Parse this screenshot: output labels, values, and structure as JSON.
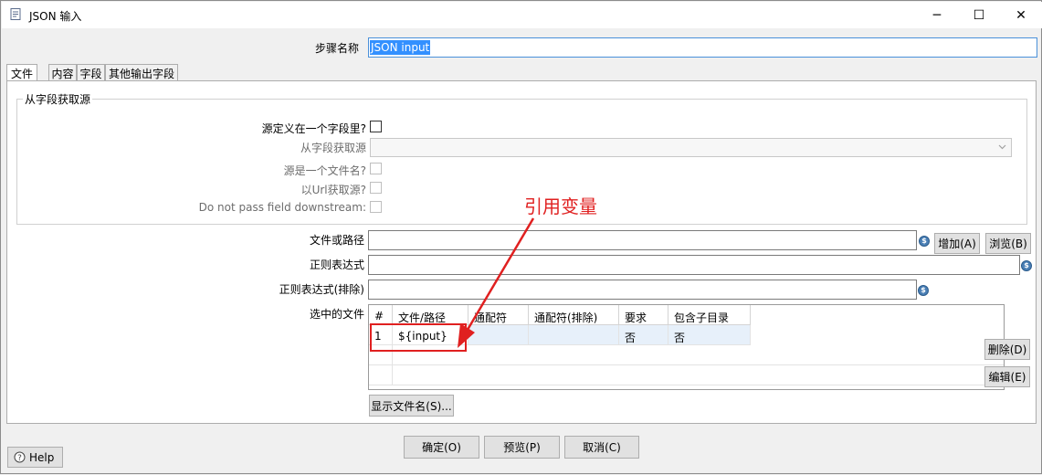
{
  "window": {
    "title": "JSON 输入",
    "minimize_glyph": "─",
    "maximize_glyph": "☐",
    "close_glyph": "✕"
  },
  "step": {
    "label": "步骤名称",
    "value": "JSON input"
  },
  "tabs": [
    {
      "label": "文件",
      "active": true
    },
    {
      "label": "内容",
      "active": false
    },
    {
      "label": "字段",
      "active": false
    },
    {
      "label": "其他输出字段",
      "active": false
    }
  ],
  "source_group": {
    "title": "从字段获取源",
    "source_in_field_label": "源定义在一个字段里?",
    "get_source_from_field_label": "从字段获取源",
    "source_is_filename_label": "源是一个文件名?",
    "read_source_as_url_label": "以Url获取源?",
    "do_not_pass_field_label": "Do not pass field downstream:"
  },
  "file": {
    "file_or_dir_label": "文件或路径",
    "add_button": "增加(A)",
    "browse_button": "浏览(B)",
    "regex_label": "正则表达式",
    "regex_exclude_label": "正则表达式(排除)",
    "selected_files_label": "选中的文件",
    "delete_button": "删除(D)",
    "edit_button": "编辑(E)",
    "show_filenames_button": "显示文件名(S)...",
    "var_icon_glyph": "$"
  },
  "table": {
    "columns": [
      "#",
      "文件/路径",
      "通配符",
      "通配符(排除)",
      "要求",
      "包含子目录"
    ],
    "rows": [
      {
        "index": "1",
        "path": "${input}",
        "wildcard": "",
        "wildcard_exclude": "",
        "required": "否",
        "include_subfolders": "否"
      }
    ]
  },
  "annotation": {
    "text": "引用变量",
    "color": "#e02020"
  },
  "footer": {
    "ok_button": "确定(O)",
    "preview_button": "预览(P)",
    "cancel_button": "取消(C)",
    "help_button": "Help"
  }
}
